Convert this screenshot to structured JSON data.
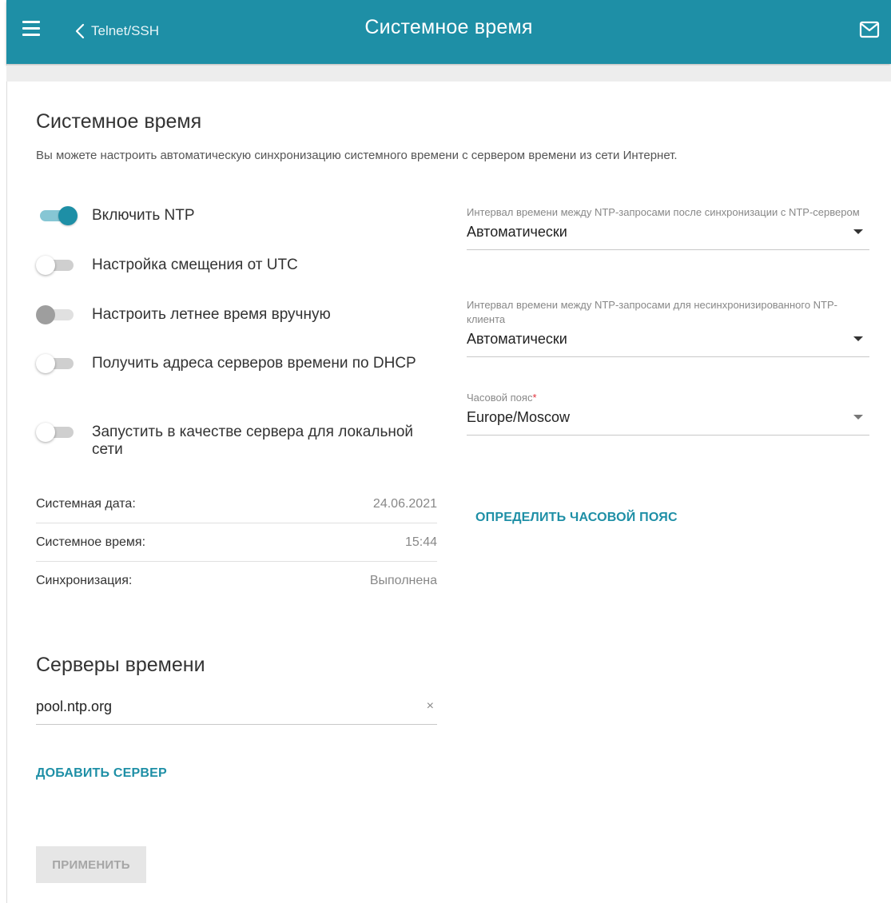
{
  "header": {
    "back_label": "Telnet/SSH",
    "title": "Системное время"
  },
  "section": {
    "title": "Системное время",
    "description": "Вы можете настроить автоматическую синхронизацию системного времени с сервером времени из сети Интернет."
  },
  "toggles": {
    "ntp": {
      "label": "Включить NTP",
      "state": "on"
    },
    "utc_offset": {
      "label": "Настройка смещения от UTC",
      "state": "off"
    },
    "dst_manual": {
      "label": "Настроить летнее время вручную",
      "state": "disabled"
    },
    "dhcp_servers": {
      "label": "Получить адреса серверов времени по DHCP",
      "state": "off"
    },
    "lan_server": {
      "label": "Запустить в качестве сервера для локальной сети",
      "state": "off"
    }
  },
  "status": {
    "date_label": "Системная дата:",
    "date_value": "24.06.2021",
    "time_label": "Системное время:",
    "time_value": "15:44",
    "sync_label": "Синхронизация:",
    "sync_value": "Выполнена"
  },
  "servers": {
    "title": "Серверы времени",
    "items": [
      "pool.ntp.org"
    ],
    "clear_glyph": "×",
    "add_label": "ДОБАВИТЬ СЕРВЕР"
  },
  "fields": {
    "interval_sync": {
      "label": "Интервал времени между NTP-запросами после синхронизации с NTP-сервером",
      "value": "Автоматически"
    },
    "interval_unsync": {
      "label": "Интервал времени между NTP-запросами для несинхронизированного NTP-клиента",
      "value": "Автоматически"
    },
    "timezone": {
      "label": "Часовой пояс",
      "required_mark": "*",
      "value": "Europe/Moscow"
    }
  },
  "detect_tz_label": "ОПРЕДЕЛИТЬ ЧАСОВОЙ ПОЯС",
  "apply_label": "ПРИМЕНИТЬ",
  "icons": {
    "menu": "hamburger-icon",
    "back": "chevron-left-icon",
    "mail": "mail-icon",
    "clear": "close-icon",
    "dropdown": "caret-down-icon"
  },
  "colors": {
    "accent": "#1e8fa6",
    "toggle_track_on": "#86c6d4",
    "required": "#e0303a",
    "disabled_button": "#e6e6e6"
  }
}
